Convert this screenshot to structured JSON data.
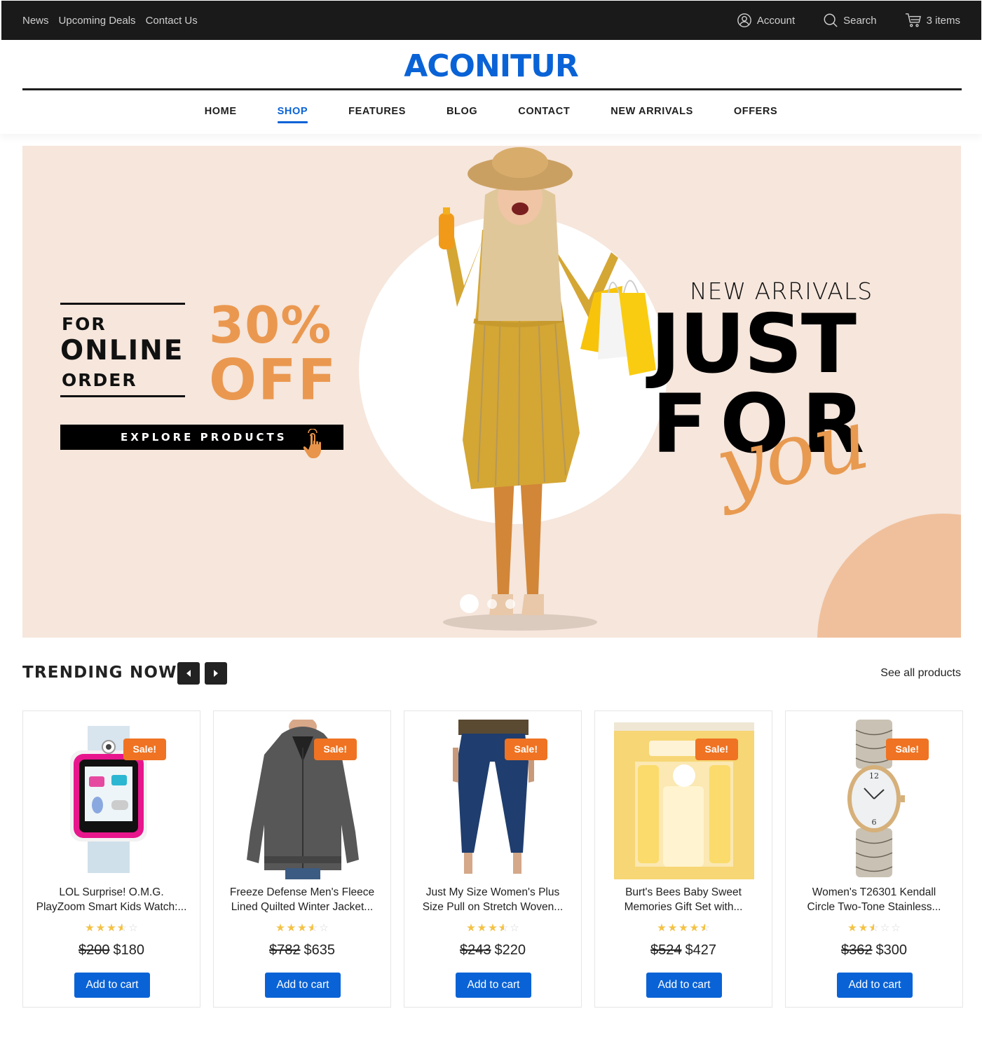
{
  "topbar": {
    "links": [
      {
        "label": "News"
      },
      {
        "label": "Upcoming Deals"
      },
      {
        "label": "Contact Us"
      }
    ],
    "account_label": "Account",
    "search_label": "Search",
    "cart_label": "3 items"
  },
  "header": {
    "logo": "ACONITUR",
    "nav": [
      {
        "label": "HOME",
        "active": false
      },
      {
        "label": "SHOP",
        "active": true
      },
      {
        "label": "FEATURES",
        "active": false
      },
      {
        "label": "BLOG",
        "active": false
      },
      {
        "label": "CONTACT",
        "active": false
      },
      {
        "label": "NEW ARRIVALS",
        "active": false
      },
      {
        "label": "OFFERS",
        "active": false
      }
    ]
  },
  "banner": {
    "for": "FOR",
    "online": "ONLINE",
    "order": "ORDER",
    "discount": "30%",
    "off": "OFF",
    "cta": "EXPLORE PRODUCTS",
    "new_arrivals": "NEW ARRIVALS",
    "just": "JUST",
    "for_big": "FOR",
    "you": "you",
    "slides": 3,
    "active_slide": 1
  },
  "colors": {
    "brand": "#0a63d6",
    "accent_orange": "#ea9850",
    "sale_badge": "#ef7322",
    "banner_bg": "#f6e6dc",
    "star": "#f5c242",
    "topbar_bg": "#1a1a1a"
  },
  "trending": {
    "title": "TRENDING NOW",
    "prev_icon": "caret-left-icon",
    "next_icon": "caret-right-icon",
    "see_all": "See all products",
    "products": [
      {
        "title_line1": "LOL Surprise! O.M.G.",
        "title_line2": "PlayZoom Smart Kids Watch:...",
        "badge": "Sale!",
        "rating": 3.5,
        "old_price": "$200",
        "price": "$180",
        "button": "Add to cart",
        "image": "kids-smartwatch"
      },
      {
        "title_line1": "Freeze Defense Men's Fleece",
        "title_line2": "Lined Quilted Winter Jacket...",
        "badge": "Sale!",
        "rating": 3.5,
        "old_price": "$782",
        "price": "$635",
        "button": "Add to cart",
        "image": "winter-jacket"
      },
      {
        "title_line1": "Just My Size Women's Plus",
        "title_line2": "Size Pull on Stretch Woven...",
        "badge": "Sale!",
        "rating": 3.5,
        "old_price": "$243",
        "price": "$220",
        "button": "Add to cart",
        "image": "blue-pants"
      },
      {
        "title_line1": "Burt's Bees Baby Sweet",
        "title_line2": "Memories Gift Set with...",
        "badge": "Sale!",
        "rating": 4.5,
        "old_price": "$524",
        "price": "$427",
        "button": "Add to cart",
        "image": "gift-set"
      },
      {
        "title_line1": "Women's T26301 Kendall",
        "title_line2": "Circle Two-Tone Stainless...",
        "badge": "Sale!",
        "rating": 2.5,
        "old_price": "$362",
        "price": "$300",
        "button": "Add to cart",
        "image": "womens-watch"
      }
    ]
  }
}
